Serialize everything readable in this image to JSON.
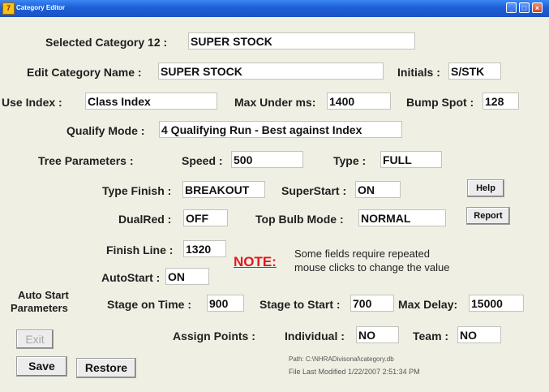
{
  "window": {
    "title": "Category Editor",
    "app_icon_glyph": "7",
    "controls": {
      "minimize": "_",
      "maximize": "□",
      "close": "×"
    }
  },
  "fields": {
    "selected_category": {
      "label": "Selected Category 12 :",
      "value": "SUPER STOCK"
    },
    "edit_category_name": {
      "label": "Edit Category Name :",
      "value": "SUPER STOCK"
    },
    "initials": {
      "label": "Initials :",
      "value": "S/STK"
    },
    "use_index": {
      "label": "Use Index :",
      "value": "Class Index"
    },
    "max_under_ms": {
      "label": "Max Under ms:",
      "value": "1400"
    },
    "bump_spot": {
      "label": "Bump Spot :",
      "value": "128"
    },
    "qualify_mode": {
      "label": "Qualify Mode :",
      "value": "4  Qualifying Run - Best against Index"
    },
    "tree_parameters_label": "Tree Parameters :",
    "speed": {
      "label": "Speed :",
      "value": "500"
    },
    "type": {
      "label": "Type :",
      "value": "FULL"
    },
    "type_finish": {
      "label": "Type Finish :",
      "value": "BREAKOUT"
    },
    "superstart": {
      "label": "SuperStart :",
      "value": "ON"
    },
    "dualred": {
      "label": "DualRed :",
      "value": "OFF"
    },
    "top_bulb_mode": {
      "label": "Top Bulb Mode :",
      "value": "NORMAL"
    },
    "finish_line": {
      "label": "Finish Line :",
      "value": "1320"
    },
    "autostart": {
      "label": "AutoStart :",
      "value": "ON"
    },
    "auto_start_parameters_label": [
      "Auto Start",
      "Parameters"
    ],
    "stage_on_time": {
      "label": "Stage on Time :",
      "value": "900"
    },
    "stage_to_start": {
      "label": "Stage to Start :",
      "value": "700"
    },
    "max_delay": {
      "label": "Max Delay:",
      "value": "15000"
    },
    "assign_points_label": "Assign Points :",
    "individual": {
      "label": "Individual :",
      "value": "NO"
    },
    "team": {
      "label": "Team :",
      "value": "NO"
    }
  },
  "buttons": {
    "help": "Help",
    "report": "Report",
    "exit": "Exit",
    "save": "Save",
    "restore": "Restore"
  },
  "note": {
    "label": "NOTE:",
    "lines": [
      "Some fields require repeated",
      "mouse clicks to change the value"
    ]
  },
  "footer": {
    "path": "Path: C:\\NHRADivisonal\\category.db",
    "last_modified": "File Last Modified 1/22/2007 2:51:34 PM"
  },
  "colors": {
    "titlebar": "#1d5fd6",
    "background": "#f0efe4",
    "note": "#e4171b"
  }
}
